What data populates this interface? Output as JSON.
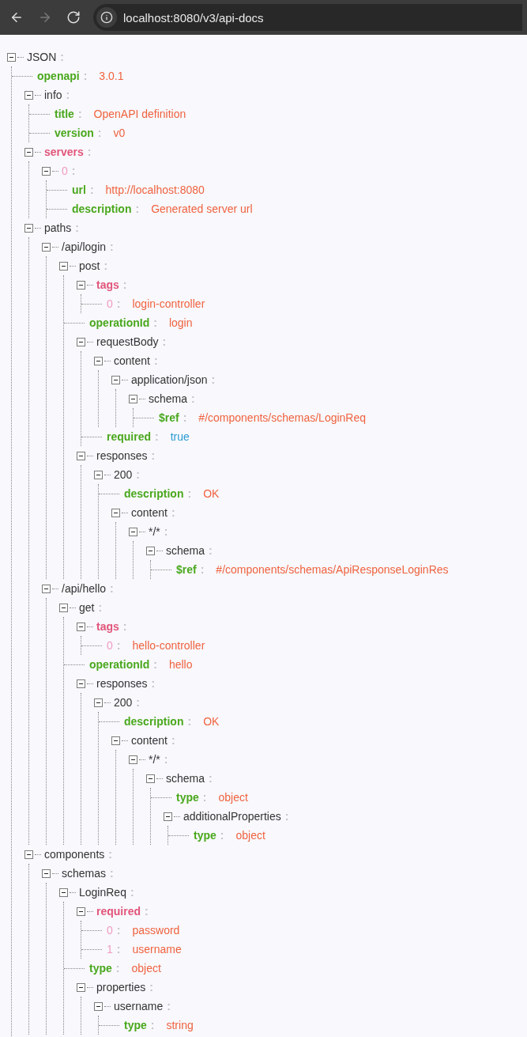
{
  "browser": {
    "nav": [
      {
        "kind": "back",
        "disabled": false
      },
      {
        "kind": "forward",
        "disabled": true
      },
      {
        "kind": "reload",
        "disabled": false
      }
    ],
    "url": "localhost:8080/v3/api-docs"
  },
  "separator": ":",
  "tree": {
    "key": "JSON",
    "kind": "object",
    "expanded": true,
    "children": [
      {
        "key": "openapi",
        "kind": "leaf",
        "value": "3.0.1"
      },
      {
        "key": "info",
        "kind": "object",
        "expanded": true,
        "children": [
          {
            "key": "title",
            "kind": "leaf",
            "value": "OpenAPI definition"
          },
          {
            "key": "version",
            "kind": "leaf",
            "value": "v0"
          }
        ]
      },
      {
        "key": "servers",
        "kind": "array",
        "expanded": true,
        "children": [
          {
            "key": "0",
            "kind": "index",
            "expanded": true,
            "children": [
              {
                "key": "url",
                "kind": "leaf",
                "value": "http://localhost:8080"
              },
              {
                "key": "description",
                "kind": "leaf",
                "value": "Generated server url"
              }
            ]
          }
        ]
      },
      {
        "key": "paths",
        "kind": "object",
        "expanded": true,
        "children": [
          {
            "key": "/api/login",
            "kind": "object",
            "expanded": true,
            "children": [
              {
                "key": "post",
                "kind": "object",
                "expanded": true,
                "children": [
                  {
                    "key": "tags",
                    "kind": "array",
                    "expanded": true,
                    "children": [
                      {
                        "key": "0",
                        "kind": "item",
                        "value": "login-controller"
                      }
                    ]
                  },
                  {
                    "key": "operationId",
                    "kind": "leaf",
                    "value": "login"
                  },
                  {
                    "key": "requestBody",
                    "kind": "object",
                    "expanded": true,
                    "children": [
                      {
                        "key": "content",
                        "kind": "object",
                        "expanded": true,
                        "children": [
                          {
                            "key": "application/json",
                            "kind": "object",
                            "expanded": true,
                            "children": [
                              {
                                "key": "schema",
                                "kind": "object",
                                "expanded": true,
                                "children": [
                                  {
                                    "key": "$ref",
                                    "kind": "leaf",
                                    "value": "#/components/schemas/LoginReq"
                                  }
                                ]
                              }
                            ]
                          }
                        ]
                      },
                      {
                        "key": "required",
                        "kind": "boolean",
                        "value": "true"
                      }
                    ]
                  },
                  {
                    "key": "responses",
                    "kind": "object",
                    "expanded": true,
                    "children": [
                      {
                        "key": "200",
                        "kind": "object",
                        "expanded": true,
                        "children": [
                          {
                            "key": "description",
                            "kind": "leaf",
                            "value": "OK"
                          },
                          {
                            "key": "content",
                            "kind": "object",
                            "expanded": true,
                            "children": [
                              {
                                "key": "*/*",
                                "kind": "object",
                                "expanded": true,
                                "children": [
                                  {
                                    "key": "schema",
                                    "kind": "object",
                                    "expanded": true,
                                    "children": [
                                      {
                                        "key": "$ref",
                                        "kind": "leaf",
                                        "value": "#/components/schemas/ApiResponseLoginRes"
                                      }
                                    ]
                                  }
                                ]
                              }
                            ]
                          }
                        ]
                      }
                    ]
                  }
                ]
              }
            ]
          },
          {
            "key": "/api/hello",
            "kind": "object",
            "expanded": true,
            "children": [
              {
                "key": "get",
                "kind": "object",
                "expanded": true,
                "children": [
                  {
                    "key": "tags",
                    "kind": "array",
                    "expanded": true,
                    "children": [
                      {
                        "key": "0",
                        "kind": "item",
                        "value": "hello-controller"
                      }
                    ]
                  },
                  {
                    "key": "operationId",
                    "kind": "leaf",
                    "value": "hello"
                  },
                  {
                    "key": "responses",
                    "kind": "object",
                    "expanded": true,
                    "children": [
                      {
                        "key": "200",
                        "kind": "object",
                        "expanded": true,
                        "children": [
                          {
                            "key": "description",
                            "kind": "leaf",
                            "value": "OK"
                          },
                          {
                            "key": "content",
                            "kind": "object",
                            "expanded": true,
                            "children": [
                              {
                                "key": "*/*",
                                "kind": "object",
                                "expanded": true,
                                "children": [
                                  {
                                    "key": "schema",
                                    "kind": "object",
                                    "expanded": true,
                                    "children": [
                                      {
                                        "key": "type",
                                        "kind": "leaf",
                                        "value": "object"
                                      },
                                      {
                                        "key": "additionalProperties",
                                        "kind": "object",
                                        "expanded": true,
                                        "children": [
                                          {
                                            "key": "type",
                                            "kind": "leaf",
                                            "value": "object"
                                          }
                                        ]
                                      }
                                    ]
                                  }
                                ]
                              }
                            ]
                          }
                        ]
                      }
                    ]
                  }
                ]
              }
            ]
          }
        ]
      },
      {
        "key": "components",
        "kind": "object",
        "expanded": true,
        "children": [
          {
            "key": "schemas",
            "kind": "object",
            "expanded": true,
            "children": [
              {
                "key": "LoginReq",
                "kind": "object",
                "expanded": true,
                "children": [
                  {
                    "key": "required",
                    "kind": "array",
                    "expanded": true,
                    "children": [
                      {
                        "key": "0",
                        "kind": "item",
                        "value": "password"
                      },
                      {
                        "key": "1",
                        "kind": "item",
                        "value": "username"
                      }
                    ]
                  },
                  {
                    "key": "type",
                    "kind": "leaf",
                    "value": "object"
                  },
                  {
                    "key": "properties",
                    "kind": "object",
                    "expanded": true,
                    "children": [
                      {
                        "key": "username",
                        "kind": "object",
                        "expanded": true,
                        "children": [
                          {
                            "key": "type",
                            "kind": "leaf",
                            "value": "string"
                          }
                        ]
                      }
                    ]
                  }
                ]
              }
            ]
          }
        ]
      }
    ]
  }
}
